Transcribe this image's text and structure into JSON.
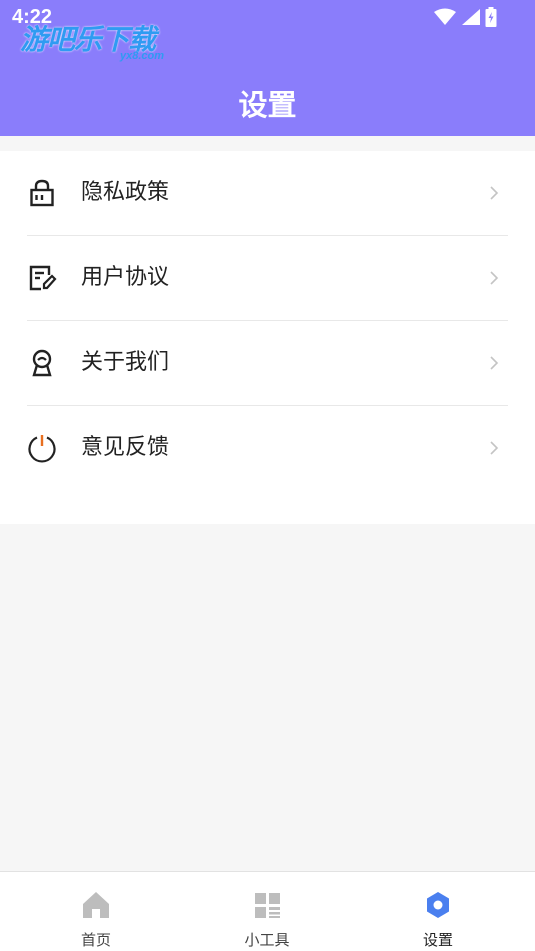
{
  "status_bar": {
    "time": "4:22"
  },
  "watermark": {
    "text": "游吧乐下载",
    "sub": "yx8.com"
  },
  "header": {
    "title": "设置"
  },
  "menu": {
    "items": [
      {
        "label": "隐私政策",
        "icon": "lock-icon"
      },
      {
        "label": "用户协议",
        "icon": "edit-document-icon"
      },
      {
        "label": "关于我们",
        "icon": "about-person-icon"
      },
      {
        "label": "意见反馈",
        "icon": "power-icon"
      }
    ]
  },
  "tabbar": {
    "tabs": [
      {
        "label": "首页",
        "icon": "home-icon",
        "active": false
      },
      {
        "label": "小工具",
        "icon": "tools-grid-icon",
        "active": false
      },
      {
        "label": "设置",
        "icon": "gear-icon",
        "active": true
      }
    ]
  },
  "colors": {
    "header_bg": "#8a7dfb",
    "active_tab": "#4a7fef",
    "inactive_icon": "#bdbdbd"
  }
}
